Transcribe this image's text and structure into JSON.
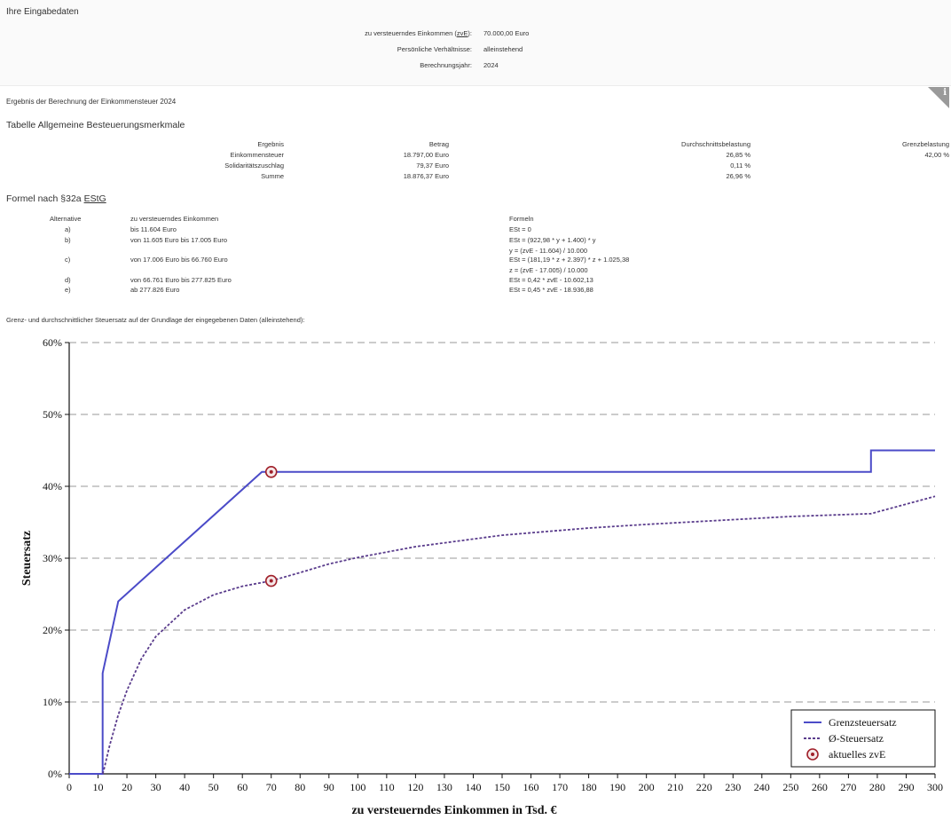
{
  "input": {
    "title": "Ihre Eingabedaten",
    "zve_label_pre": "zu versteuerndes Einkommen (",
    "zve_label_abbr": "zvE",
    "zve_label_post": "):",
    "zve_value": "70.000,00 Euro",
    "verhaeltnisse_label": "Persönliche Verhältnisse:",
    "verhaeltnisse_value": "alleinstehend",
    "jahr_label": "Berechnungsjahr:",
    "jahr_value": "2024"
  },
  "result": {
    "title": "Ergebnis der Berechnung der Einkommensteuer 2024",
    "info_icon": "i",
    "table_title": "Tabelle Allgemeine Besteuerungsmerkmale",
    "headers": [
      "Ergebnis",
      "Betrag",
      "Durchschnittsbelastung",
      "Grenzbelastung"
    ],
    "rows": [
      [
        "Einkommensteuer",
        "18.797,00 Euro",
        "26,85 %",
        "42,00 %"
      ],
      [
        "Solidaritätszuschlag",
        "79,37 Euro",
        "0,11 %",
        ""
      ],
      [
        "Summe",
        "18.876,37 Euro",
        "26,96 %",
        ""
      ]
    ]
  },
  "formula": {
    "title_pre": "Formel nach §32a ",
    "title_abbr": "EStG",
    "headers": [
      "Alternative",
      "zu versteuerndes Einkommen",
      "Formeln"
    ],
    "rows": [
      {
        "alt": "a)",
        "range": "bis 11.604 Euro",
        "f1": "ESt = 0",
        "f2": ""
      },
      {
        "alt": "b)",
        "range": "von 11.605 Euro bis 17.005 Euro",
        "f1": "ESt = (922,98 * y + 1.400) * y",
        "f2": "y = (zvE - 11.604) / 10.000"
      },
      {
        "alt": "c)",
        "range": "von 17.006 Euro bis 66.760 Euro",
        "f1": "ESt = (181,19 * z + 2.397) * z + 1.025,38",
        "f2": "z = (zvE - 17.005) / 10.000"
      },
      {
        "alt": "d)",
        "range": "von 66.761 Euro bis 277.825 Euro",
        "f1": "ESt = 0,42 * zvE - 10.602,13",
        "f2": ""
      },
      {
        "alt": "e)",
        "range": "ab 277.826 Euro",
        "f1": "ESt = 0,45 * zvE - 18.936,88",
        "f2": ""
      }
    ]
  },
  "chart_caption": "Grenz- und durchschnittlicher Steuersatz auf der Grundlage der eingegebenen Daten (alleinstehend):",
  "chart_data": {
    "type": "line",
    "xlabel": "zu versteuerndes Einkommen in Tsd. €",
    "ylabel": "Steuersatz",
    "xlim": [
      0,
      300
    ],
    "ylim": [
      0,
      60
    ],
    "x_ticks": [
      0,
      10,
      20,
      30,
      40,
      50,
      60,
      70,
      80,
      90,
      100,
      110,
      120,
      130,
      140,
      150,
      160,
      170,
      180,
      190,
      200,
      210,
      220,
      230,
      240,
      250,
      260,
      270,
      280,
      290,
      300
    ],
    "y_ticks": [
      0,
      10,
      20,
      30,
      40,
      50,
      60
    ],
    "y_tick_labels": [
      "0%",
      "10%",
      "20%",
      "30%",
      "40%",
      "50%",
      "60%"
    ],
    "grid": "horizontal dashed",
    "legend_position": "bottom-right",
    "series": [
      {
        "name": "Grenzsteuersatz",
        "style": "solid",
        "color": "#4b4bc8",
        "x": [
          0,
          11.6,
          11.6,
          17.0,
          66.76,
          277.8,
          277.8,
          300
        ],
        "y": [
          0,
          0,
          14,
          24,
          42,
          42,
          45,
          45
        ]
      },
      {
        "name": "Ø-Steuersatz",
        "style": "dotted",
        "color": "#5a3c8c",
        "x": [
          11.6,
          12,
          14,
          17,
          20,
          25,
          30,
          40,
          50,
          60,
          70,
          80,
          90,
          100,
          120,
          150,
          180,
          200,
          250,
          277.8,
          300
        ],
        "y": [
          0,
          0.5,
          3.9,
          8.2,
          11.6,
          16.0,
          19.1,
          22.8,
          24.9,
          26.1,
          26.85,
          28.0,
          29.2,
          30.1,
          31.6,
          33.2,
          34.2,
          34.7,
          35.8,
          36.2,
          38.6
        ]
      }
    ],
    "marker": {
      "name": "aktuelles zvE",
      "x": 70,
      "points_y": [
        42,
        26.85
      ],
      "color": "#a0202a"
    }
  }
}
